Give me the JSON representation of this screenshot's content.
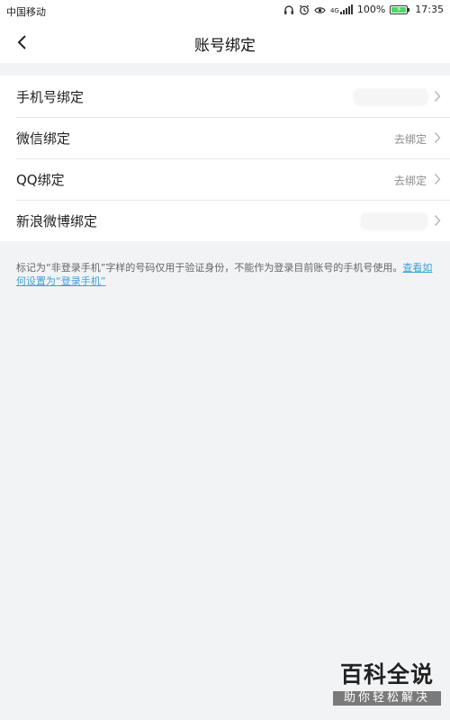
{
  "status_bar": {
    "carrier": "中国移动",
    "signal_label": "4G",
    "battery_text": "100%",
    "battery_level": 1.0,
    "time": "17:35",
    "icons": [
      "headset-icon",
      "alarm-icon",
      "eye-icon",
      "signal-icon",
      "battery-icon"
    ]
  },
  "nav": {
    "title": "账号绑定",
    "back_icon": "chevron-left-icon"
  },
  "bindings": [
    {
      "label": "手机号绑定",
      "status": ""
    },
    {
      "label": "微信绑定",
      "status": "去绑定"
    },
    {
      "label": "QQ绑定",
      "status": "去绑定"
    },
    {
      "label": "新浪微博绑定",
      "status": ""
    }
  ],
  "note": {
    "text": "标记为“非登录手机”字样的号码仅用于验证身份，不能作为登录目前账号的手机号使用。",
    "link": "查看如何设置为“登录手机”"
  },
  "watermark": {
    "title": "百科全说",
    "subtitle": "助你轻松解决"
  },
  "colors": {
    "background": "#f2f3f5",
    "link": "#3aa3d8",
    "battery_green": "#4cd964"
  }
}
